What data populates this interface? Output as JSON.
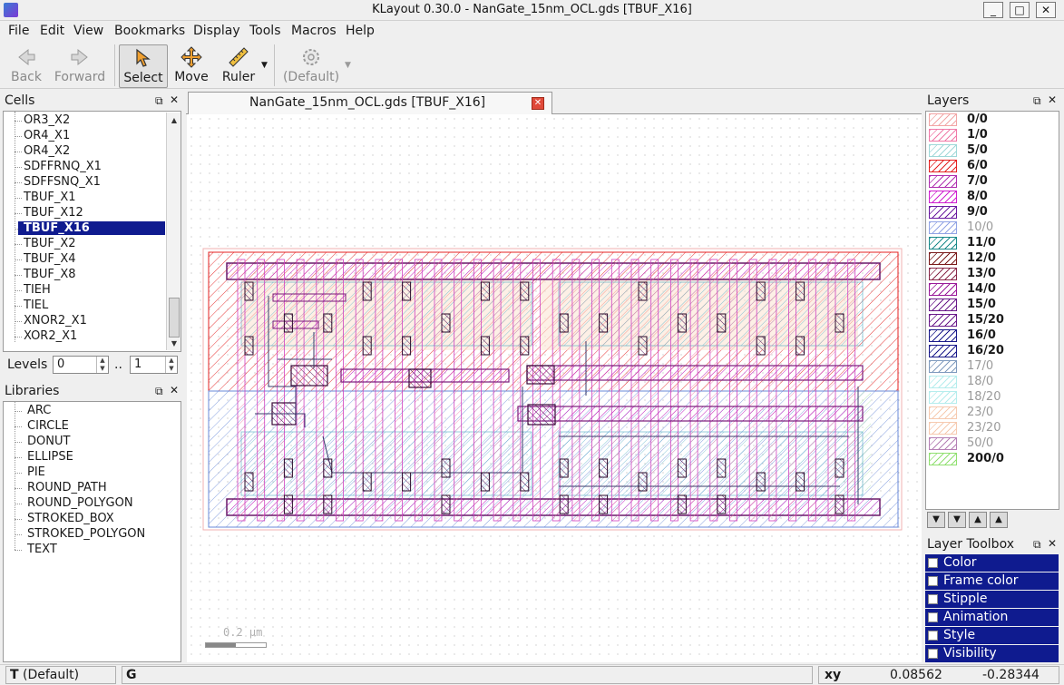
{
  "window": {
    "title": "KLayout 0.30.0 - NanGate_15nm_OCL.gds [TBUF_X16]",
    "minimize": "_",
    "maximize": "□",
    "close": "✕"
  },
  "menu": [
    "File",
    "Edit",
    "View",
    "Bookmarks",
    "Display",
    "Tools",
    "Macros",
    "Help"
  ],
  "toolbar": {
    "back": "Back",
    "forward": "Forward",
    "select": "Select",
    "move": "Move",
    "ruler": "Ruler",
    "default": "(Default)"
  },
  "cells": {
    "title": "Cells",
    "items": [
      "OR3_X2",
      "OR4_X1",
      "OR4_X2",
      "SDFFRNQ_X1",
      "SDFFSNQ_X1",
      "TBUF_X1",
      "TBUF_X12",
      "TBUF_X16",
      "TBUF_X2",
      "TBUF_X4",
      "TBUF_X8",
      "TIEH",
      "TIEL",
      "XNOR2_X1",
      "XOR2_X1"
    ],
    "selected": "TBUF_X16"
  },
  "levels": {
    "label": "Levels",
    "from": "0",
    "separator": "..",
    "to": "1"
  },
  "libraries": {
    "title": "Libraries",
    "items": [
      "ARC",
      "CIRCLE",
      "DONUT",
      "ELLIPSE",
      "PIE",
      "ROUND_PATH",
      "ROUND_POLYGON",
      "STROKED_BOX",
      "STROKED_POLYGON",
      "TEXT"
    ]
  },
  "tab": {
    "label": "NanGate_15nm_OCL.gds [TBUF_X16]",
    "close": "✕"
  },
  "scale": {
    "label": "0.2 µm"
  },
  "layers": {
    "title": "Layers",
    "items": [
      {
        "name": "0/0",
        "color": "#f2a6a6",
        "active": true
      },
      {
        "name": "1/0",
        "color": "#f07aa8",
        "active": true
      },
      {
        "name": "5/0",
        "color": "#9fd8d8",
        "active": true
      },
      {
        "name": "6/0",
        "color": "#e52222",
        "active": true
      },
      {
        "name": "7/0",
        "color": "#b030b0",
        "active": true
      },
      {
        "name": "8/0",
        "color": "#d020d0",
        "active": true
      },
      {
        "name": "9/0",
        "color": "#6a1aa0",
        "active": true
      },
      {
        "name": "10/0",
        "color": "#3a5ad0",
        "active": false
      },
      {
        "name": "11/0",
        "color": "#1a8a8a",
        "active": true
      },
      {
        "name": "12/0",
        "color": "#7a1a1a",
        "active": true
      },
      {
        "name": "13/0",
        "color": "#8a2a4a",
        "active": true
      },
      {
        "name": "14/0",
        "color": "#9a1a9a",
        "active": true
      },
      {
        "name": "15/0",
        "color": "#6a1a8a",
        "active": true
      },
      {
        "name": "15/20",
        "color": "#6a1a8a",
        "active": true
      },
      {
        "name": "16/0",
        "color": "#1a1a8a",
        "active": true
      },
      {
        "name": "16/20",
        "color": "#1a1a8a",
        "active": true
      },
      {
        "name": "17/0",
        "color": "#1a4a8a",
        "active": false
      },
      {
        "name": "18/0",
        "color": "#7ae0e0",
        "active": false
      },
      {
        "name": "18/20",
        "color": "#7ae0e0",
        "active": false
      },
      {
        "name": "23/0",
        "color": "#f0a070",
        "active": false
      },
      {
        "name": "23/20",
        "color": "#f0a070",
        "active": false
      },
      {
        "name": "50/0",
        "color": "#7a1a7a",
        "active": false
      },
      {
        "name": "200/0",
        "color": "#90e070",
        "active": true
      }
    ]
  },
  "layer_toolbox": {
    "title": "Layer Toolbox",
    "items": [
      "Color",
      "Frame color",
      "Stipple",
      "Animation",
      "Style",
      "Visibility"
    ]
  },
  "status": {
    "mode_key": "T",
    "mode_value": "(Default)",
    "grid_key": "G",
    "coord_label": "xy",
    "x": "0.08562",
    "y": "-0.28344"
  },
  "icons": [
    "back-arrow-icon",
    "forward-arrow-icon",
    "select-arrow-icon",
    "move-cross-icon",
    "ruler-icon",
    "gear-icon",
    "float-icon",
    "close-icon",
    "move-down-icon",
    "move-up-icon"
  ]
}
